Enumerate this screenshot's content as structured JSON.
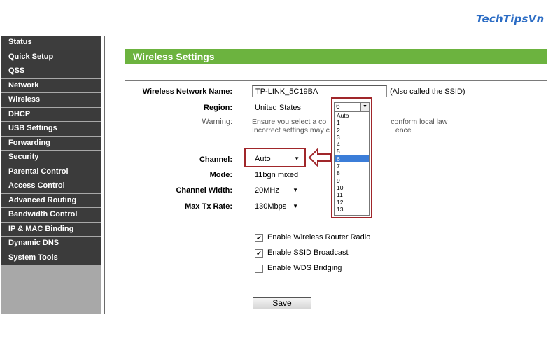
{
  "watermark": "TechTipsVn",
  "sidebar": {
    "items": [
      {
        "label": "Status"
      },
      {
        "label": "Quick Setup"
      },
      {
        "label": "QSS"
      },
      {
        "label": "Network"
      },
      {
        "label": "Wireless"
      },
      {
        "label": "DHCP"
      },
      {
        "label": "USB Settings"
      },
      {
        "label": "Forwarding"
      },
      {
        "label": "Security"
      },
      {
        "label": "Parental Control"
      },
      {
        "label": "Access Control"
      },
      {
        "label": "Advanced Routing"
      },
      {
        "label": "Bandwidth Control"
      },
      {
        "label": "IP & MAC Binding"
      },
      {
        "label": "Dynamic DNS"
      },
      {
        "label": "System Tools"
      }
    ]
  },
  "header": {
    "title": "Wireless Settings"
  },
  "form": {
    "ssid_label": "Wireless Network Name:",
    "ssid_value": "TP-LINK_5C19BA",
    "ssid_note": "(Also called the SSID)",
    "region_label": "Region:",
    "region_value": "United States",
    "warning_label": "Warning:",
    "warning_line1": "Ensure you select a co",
    "warning_line1_end": "conform local law",
    "warning_line2": "Incorrect settings may c",
    "warning_line2_end": "ence",
    "channel_label": "Channel:",
    "channel_value": "Auto",
    "mode_label": "Mode:",
    "mode_value": "11bgn mixed",
    "width_label": "Channel Width:",
    "width_value": "20MHz",
    "rate_label": "Max Tx Rate:",
    "rate_value": "130Mbps"
  },
  "channel_dropdown": {
    "selected": "6",
    "options": [
      "Auto",
      "1",
      "2",
      "3",
      "4",
      "5",
      "6",
      "7",
      "8",
      "9",
      "10",
      "11",
      "12",
      "13"
    ],
    "highlighted": "6"
  },
  "checkboxes": [
    {
      "label": "Enable Wireless Router Radio",
      "checked": true
    },
    {
      "label": "Enable SSID Broadcast",
      "checked": true
    },
    {
      "label": "Enable WDS Bridging",
      "checked": false
    }
  ],
  "save_label": "Save",
  "colors": {
    "header": "#6cb33f",
    "sidebar": "#3b3b3b",
    "highlight": "#a0262a",
    "selection": "#3b7dd8"
  }
}
